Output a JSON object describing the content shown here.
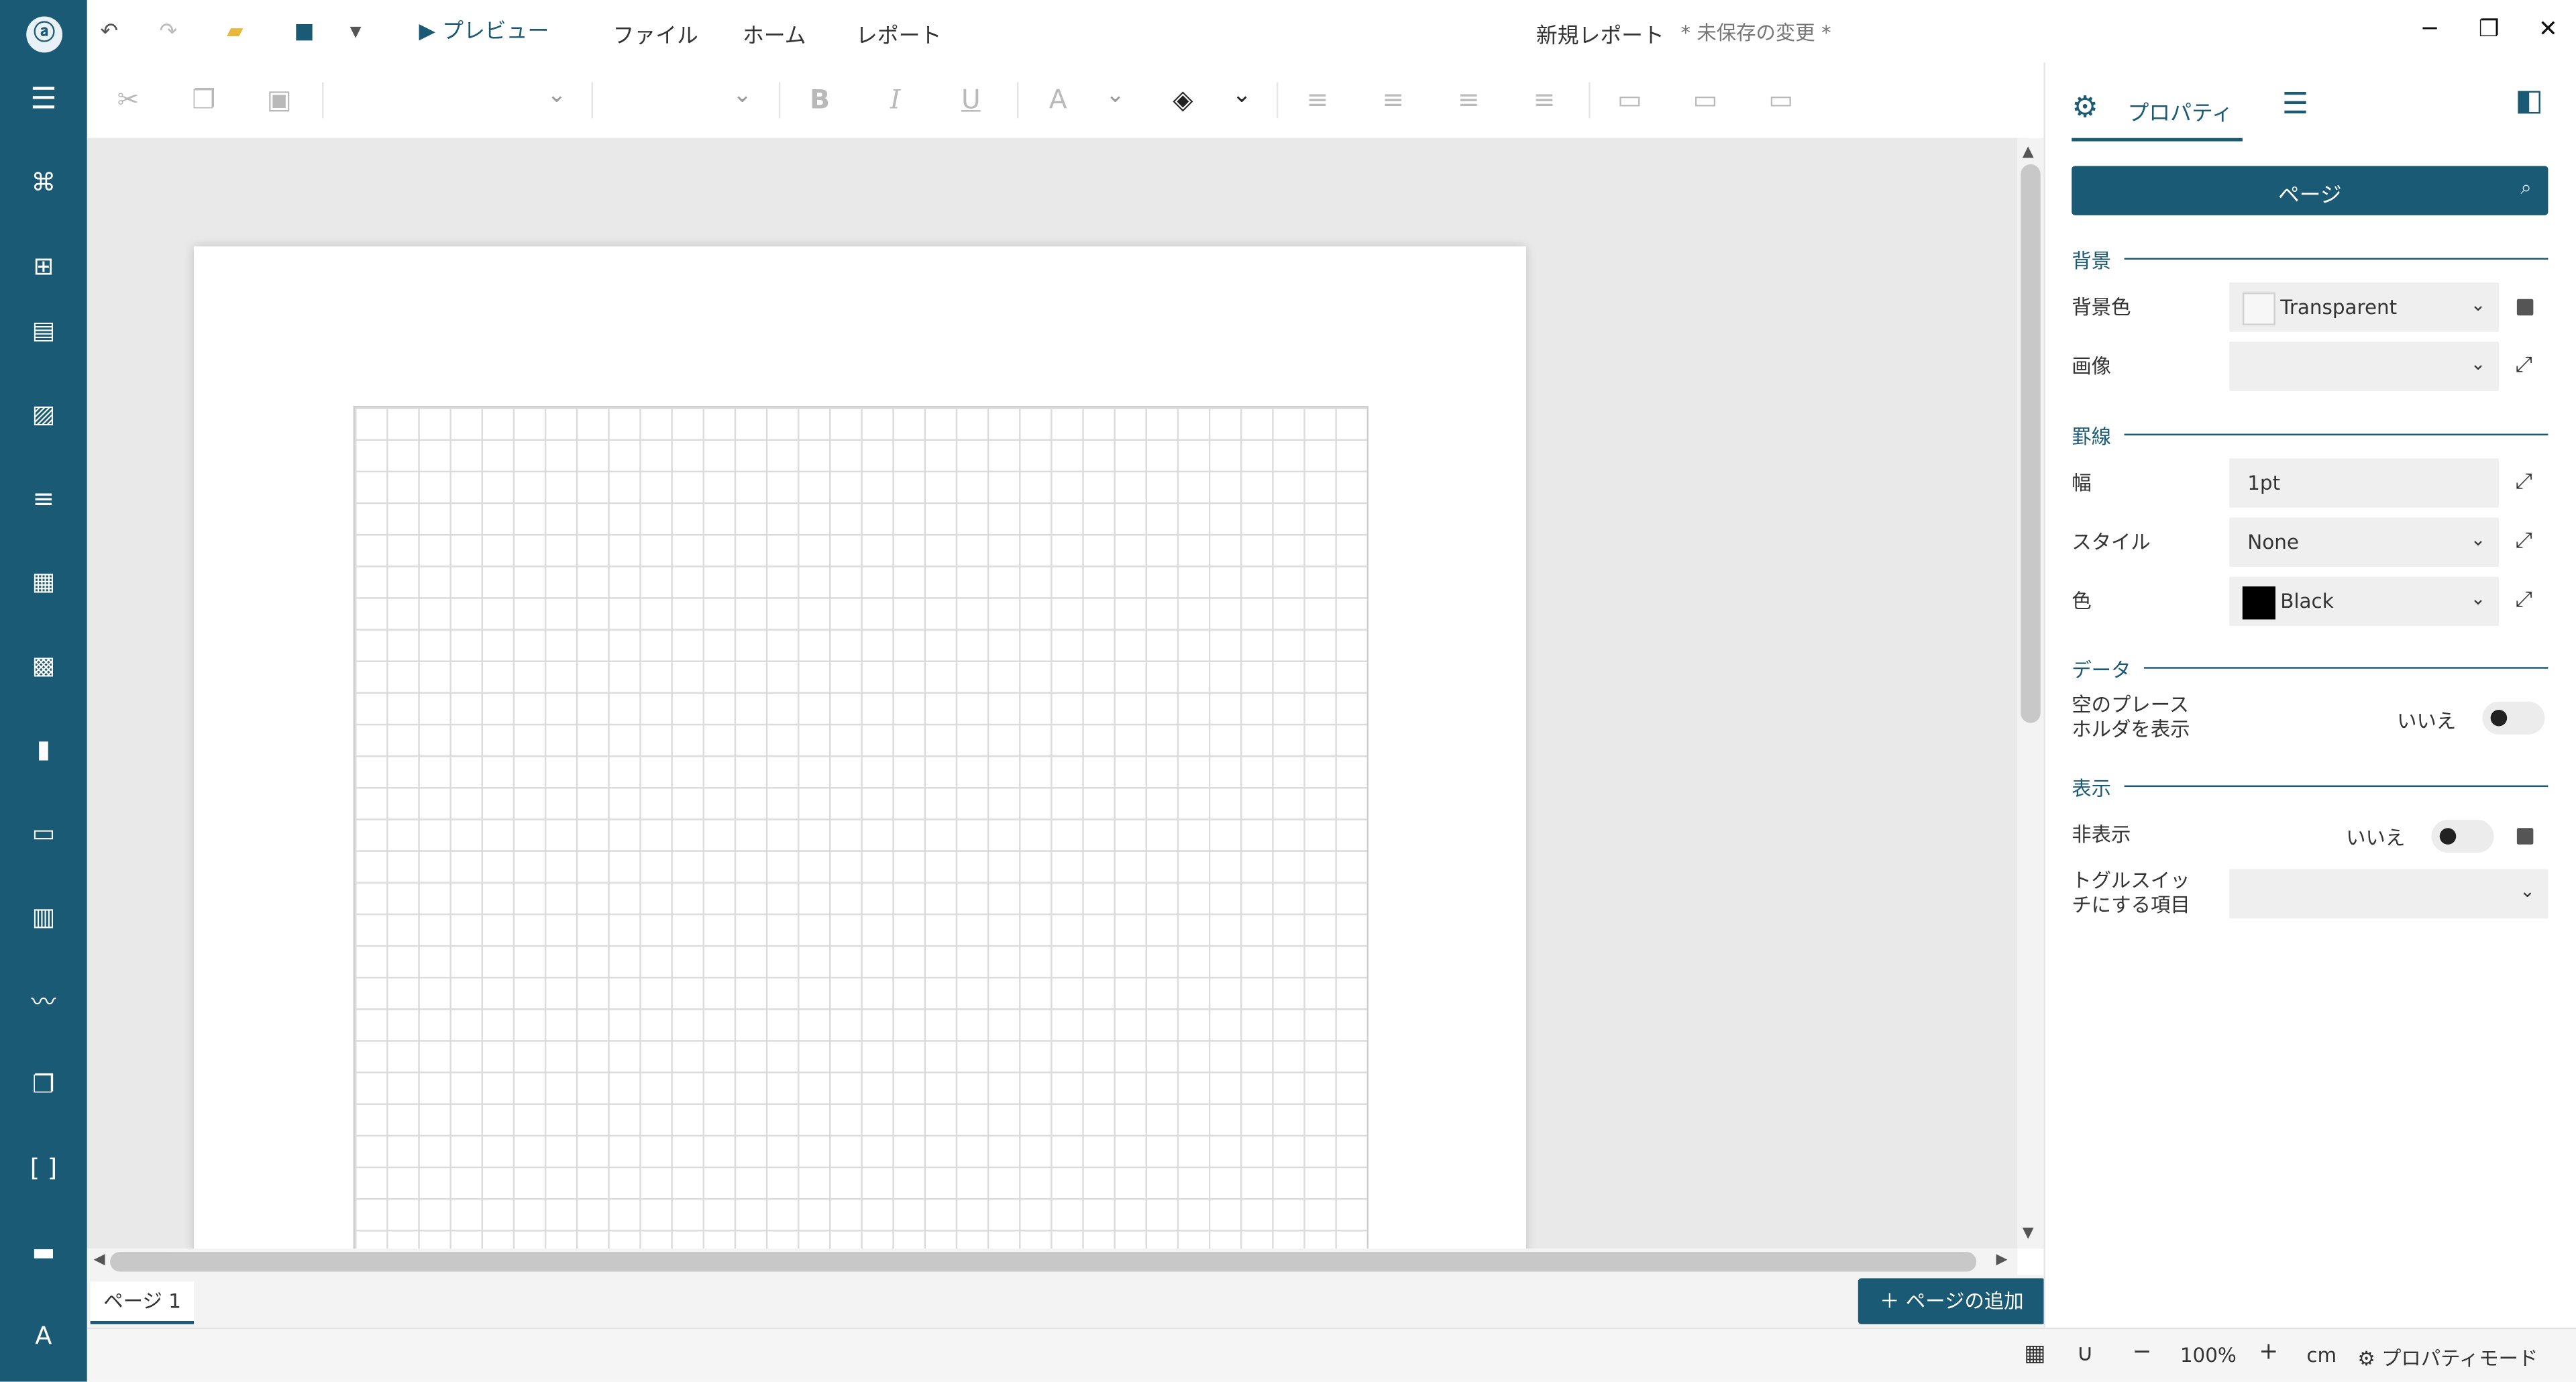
{
  "titlebar": {
    "preview": "プレビュー",
    "menu": [
      "ファイル",
      "ホーム",
      "レポート"
    ],
    "title": "新規レポート",
    "unsaved": "* 未保存の変更 *"
  },
  "right_panel": {
    "tab_properties": "プロパティ",
    "search_label": "ページ",
    "sections": {
      "background": "背景",
      "border": "罫線",
      "data": "データ",
      "display": "表示"
    },
    "rows": {
      "bg_color_label": "背景色",
      "bg_color_value": "Transparent",
      "image_label": "画像",
      "width_label": "幅",
      "width_value": "1pt",
      "style_label": "スタイル",
      "style_value": "None",
      "color_label": "色",
      "color_value": "Black",
      "placeholder_label_1": "空のプレース",
      "placeholder_label_2": "ホルダを表示",
      "placeholder_value": "いいえ",
      "hidden_label": "非表示",
      "hidden_value": "いいえ",
      "toggle_label_1": "トグルスイッ",
      "toggle_label_2": "チにする項目"
    }
  },
  "pages": {
    "tab": "ページ 1",
    "add": "ページの追加"
  },
  "status": {
    "zoom": "100%",
    "unit": "cm",
    "mode": "プロパティモード"
  },
  "colors": {
    "accent": "#1b5a75",
    "canvas": "#e9e9e9"
  }
}
